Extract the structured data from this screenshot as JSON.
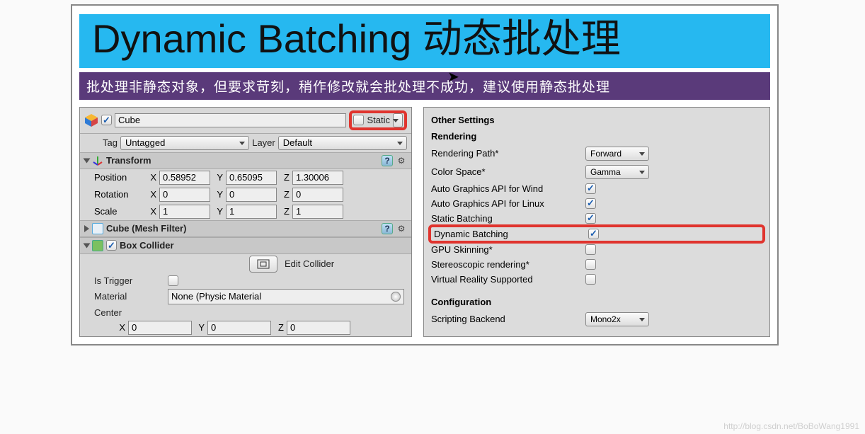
{
  "title": "Dynamic Batching 动态批处理",
  "subtitle": "批处理非静态对象，但要求苛刻，稍作修改就会批处理不成功，建议使用静态批处理",
  "inspector": {
    "name": "Cube",
    "active_checked": true,
    "static_label": "Static",
    "static_checked": false,
    "tag_label": "Tag",
    "tag_value": "Untagged",
    "layer_label": "Layer",
    "layer_value": "Default",
    "transform": {
      "title": "Transform",
      "position_label": "Position",
      "rotation_label": "Rotation",
      "scale_label": "Scale",
      "x": "X",
      "y": "Y",
      "z": "Z",
      "pos": {
        "x": "0.58952",
        "y": "0.65095",
        "z": "1.30006"
      },
      "rot": {
        "x": "0",
        "y": "0",
        "z": "0"
      },
      "scl": {
        "x": "1",
        "y": "1",
        "z": "1"
      }
    },
    "mesh_filter_title": "Cube (Mesh Filter)",
    "box_collider": {
      "title": "Box Collider",
      "enabled": true,
      "edit_label": "Edit Collider",
      "is_trigger_label": "Is Trigger",
      "is_trigger_checked": false,
      "material_label": "Material",
      "material_value": "None (Physic Material",
      "center_label": "Center",
      "center": {
        "x": "0",
        "y": "0",
        "z": "0"
      }
    }
  },
  "settings": {
    "other": "Other Settings",
    "rendering": "Rendering",
    "rendering_path_label": "Rendering Path*",
    "rendering_path_value": "Forward",
    "color_space_label": "Color Space*",
    "color_space_value": "Gamma",
    "auto_win_label": "Auto Graphics API for Wind",
    "auto_win_checked": true,
    "auto_linux_label": "Auto Graphics API for Linux",
    "auto_linux_checked": true,
    "static_batching_label": "Static Batching",
    "static_batching_checked": true,
    "dynamic_batching_label": "Dynamic Batching",
    "dynamic_batching_checked": true,
    "gpu_skinning_label": "GPU Skinning*",
    "gpu_skinning_checked": false,
    "stereo_label": "Stereoscopic rendering*",
    "stereo_checked": false,
    "vr_label": "Virtual Reality Supported",
    "vr_checked": false,
    "configuration": "Configuration",
    "scripting_label": "Scripting Backend",
    "scripting_value": "Mono2x"
  },
  "watermark": "http://blog.csdn.net/BoBoWang1991"
}
